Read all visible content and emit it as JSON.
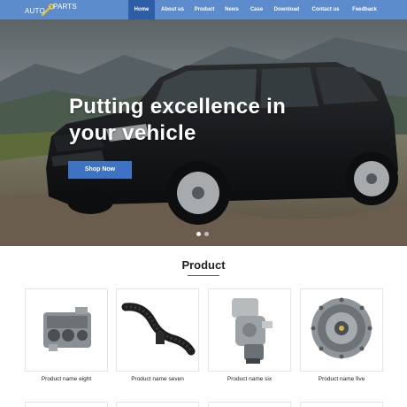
{
  "header": {
    "logo_left": "AUTO",
    "logo_right": "PARTS",
    "nav": [
      {
        "label": "Home",
        "active": true
      },
      {
        "label": "About us",
        "active": false
      },
      {
        "label": "Product",
        "active": false
      },
      {
        "label": "News",
        "active": false
      },
      {
        "label": "Case",
        "active": false
      },
      {
        "label": "Download",
        "active": false
      },
      {
        "label": "Contact us",
        "active": false
      },
      {
        "label": "Feedback",
        "active": false
      }
    ]
  },
  "hero": {
    "title": "Putting excellence in your vehicle",
    "button_label": "Shop Now",
    "slides": 2,
    "active_slide": 1
  },
  "products": {
    "section_title": "Product",
    "items": [
      {
        "name": "Product name eight",
        "icon": "engine-block-icon"
      },
      {
        "name": "Product name seven",
        "icon": "intake-hose-icon"
      },
      {
        "name": "Product name six",
        "icon": "differential-icon"
      },
      {
        "name": "Product name five",
        "icon": "transmission-icon"
      }
    ]
  },
  "colors": {
    "header": "#5c8ccc",
    "nav_active": "#2d5ea6",
    "button": "#3d73c2"
  }
}
